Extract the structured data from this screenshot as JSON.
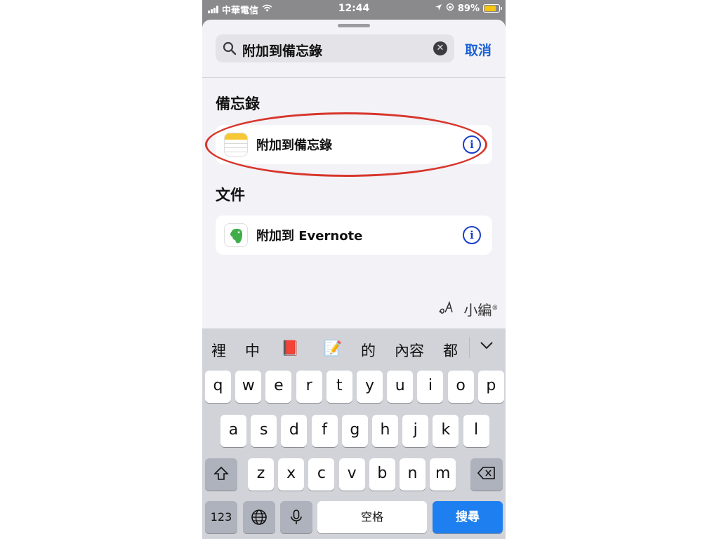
{
  "status_bar": {
    "carrier": "中華電信",
    "time": "12:44",
    "battery_percent": "89%",
    "battery_level": 0.89
  },
  "search": {
    "query": "附加到備忘錄",
    "cancel_label": "取消"
  },
  "sections": [
    {
      "title": "備忘錄",
      "items": [
        {
          "label": "附加到備忘錄",
          "icon": "notes-app-icon"
        }
      ]
    },
    {
      "title": "文件",
      "items": [
        {
          "label": "附加到 Evernote",
          "icon": "evernote-app-icon"
        }
      ]
    }
  ],
  "watermark": {
    "text": "小編"
  },
  "keyboard": {
    "candidates": [
      "裡",
      "中",
      "📕",
      "📝",
      "的",
      "內容",
      "都"
    ],
    "row1": [
      "q",
      "w",
      "e",
      "r",
      "t",
      "y",
      "u",
      "i",
      "o",
      "p"
    ],
    "row2": [
      "a",
      "s",
      "d",
      "f",
      "g",
      "h",
      "j",
      "k",
      "l"
    ],
    "row3": [
      "z",
      "x",
      "c",
      "v",
      "b",
      "n",
      "m"
    ],
    "numbers_label": "123",
    "space_label": "空格",
    "search_label": "搜尋"
  },
  "colors": {
    "accent": "#1a62d6",
    "info_icon": "#1a3fc9",
    "highlight_ring": "#d8352b",
    "search_key": "#1e7ff1"
  }
}
